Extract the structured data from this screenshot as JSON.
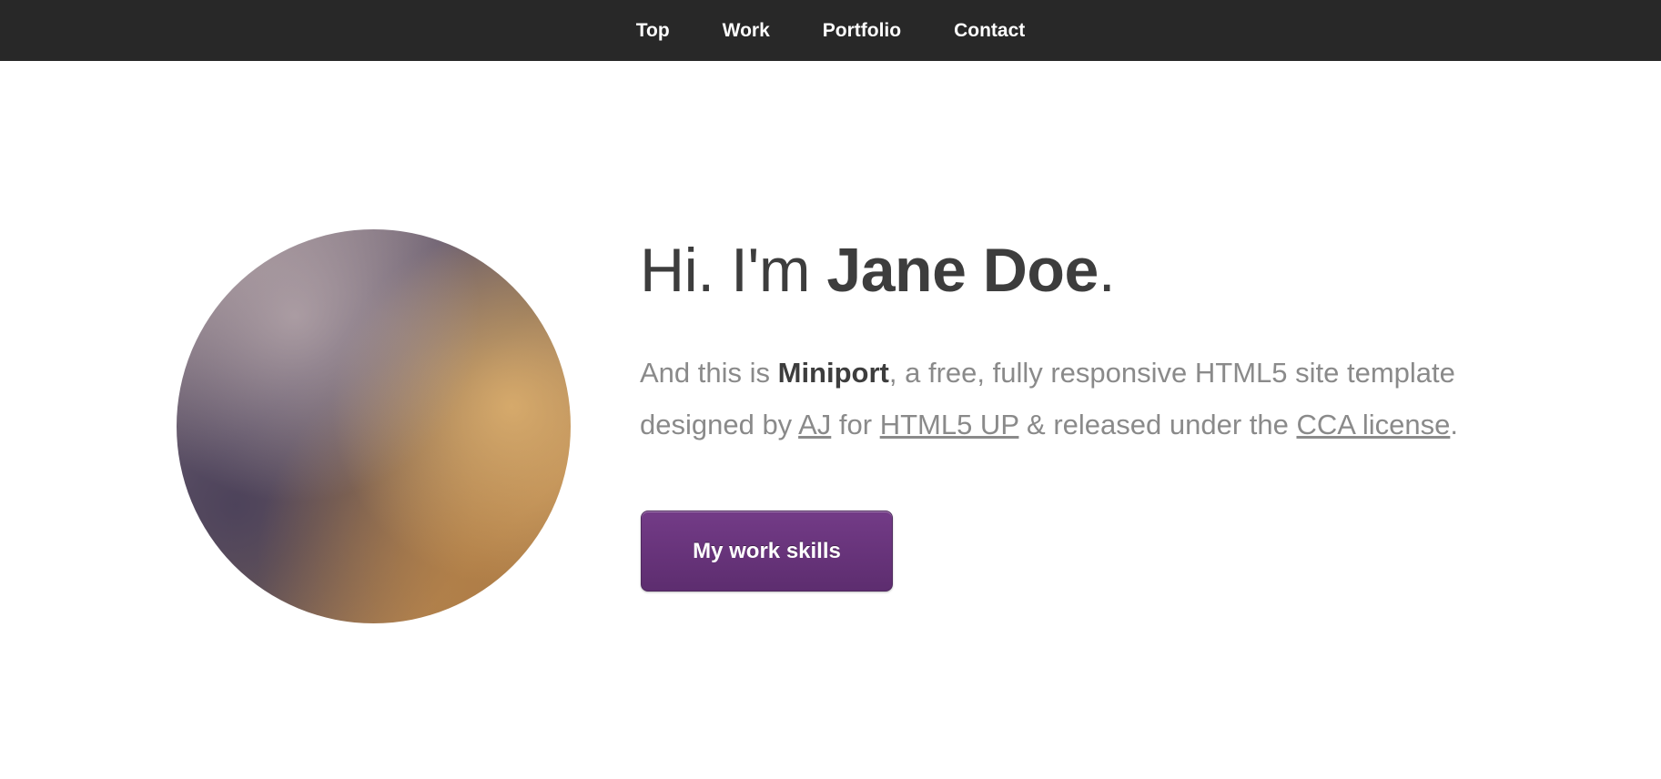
{
  "nav": {
    "items": [
      {
        "label": "Top"
      },
      {
        "label": "Work"
      },
      {
        "label": "Portfolio"
      },
      {
        "label": "Contact"
      }
    ]
  },
  "hero": {
    "greeting": "Hi. I'm ",
    "name": "Jane Doe",
    "greeting_end": ".",
    "intro": {
      "part1": "And this is ",
      "template_name": "Miniport",
      "part2": ", a free, fully responsive HTML5 site template designed by ",
      "author_link": "AJ",
      "part3": " for ",
      "site_link": "HTML5 UP",
      "part4": " & released under the ",
      "license_link": "CCA license",
      "part5": "."
    },
    "cta_label": "My work skills"
  },
  "colors": {
    "nav_background": "#282828",
    "nav_text": "#ffffff",
    "heading_text": "#3d3d3d",
    "body_text": "#8a8a8a",
    "button_background": "#6a3580",
    "button_text": "#ffffff"
  }
}
